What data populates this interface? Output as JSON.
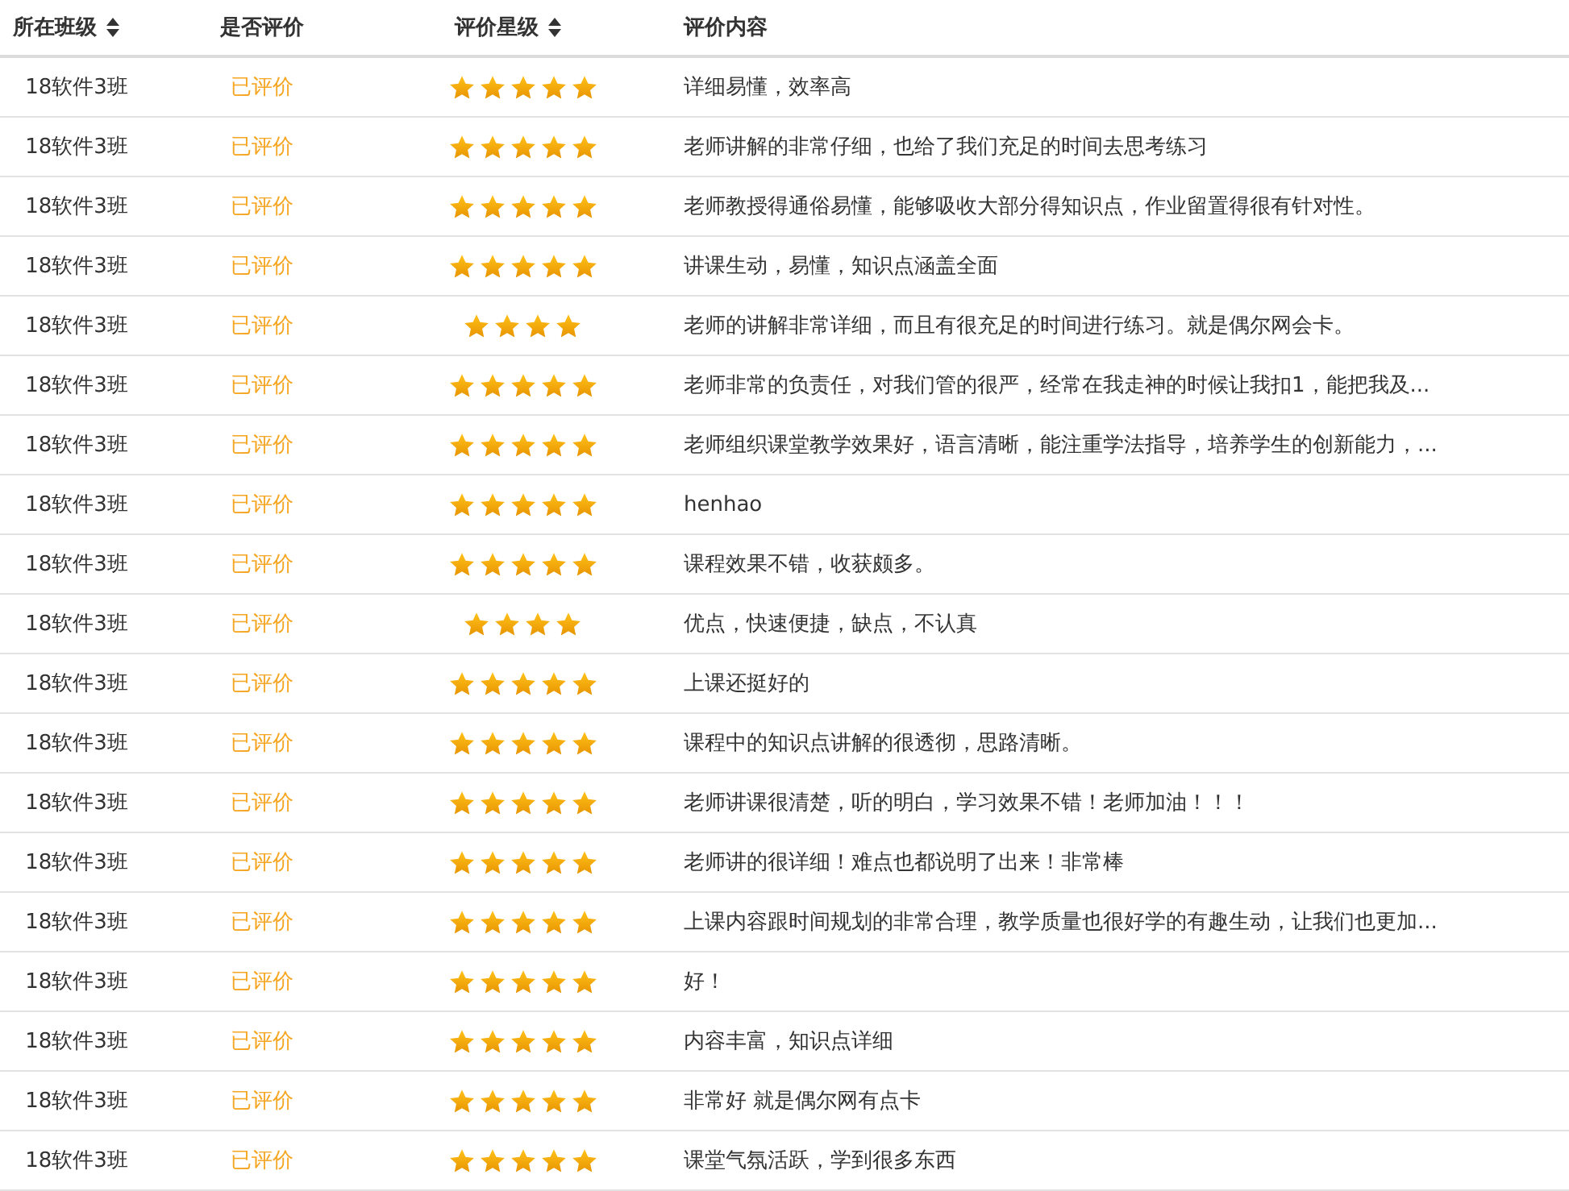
{
  "table": {
    "columns": [
      {
        "label": "所在班级",
        "sortable": true
      },
      {
        "label": "是否评价",
        "sortable": false
      },
      {
        "label": "评价星级",
        "sortable": true
      },
      {
        "label": "评价内容",
        "sortable": false
      }
    ],
    "rows": [
      {
        "class": "18软件3班",
        "status": "已评价",
        "stars": 5,
        "comment": "详细易懂，效率高"
      },
      {
        "class": "18软件3班",
        "status": "已评价",
        "stars": 5,
        "comment": "老师讲解的非常仔细，也给了我们充足的时间去思考练习"
      },
      {
        "class": "18软件3班",
        "status": "已评价",
        "stars": 5,
        "comment": "老师教授得通俗易懂，能够吸收大部分得知识点，作业留置得很有针对性。"
      },
      {
        "class": "18软件3班",
        "status": "已评价",
        "stars": 5,
        "comment": "讲课生动，易懂，知识点涵盖全面"
      },
      {
        "class": "18软件3班",
        "status": "已评价",
        "stars": 4,
        "comment": "老师的讲解非常详细，而且有很充足的时间进行练习。就是偶尔网会卡。"
      },
      {
        "class": "18软件3班",
        "status": "已评价",
        "stars": 5,
        "comment": "老师非常的负责任，对我们管的很严，经常在我走神的时候让我扣1，能把我及..."
      },
      {
        "class": "18软件3班",
        "status": "已评价",
        "stars": 5,
        "comment": "老师组织课堂教学效果好，语言清晰，能注重学法指导，培养学生的创新能力，..."
      },
      {
        "class": "18软件3班",
        "status": "已评价",
        "stars": 5,
        "comment": "henhao"
      },
      {
        "class": "18软件3班",
        "status": "已评价",
        "stars": 5,
        "comment": "课程效果不错，收获颇多。"
      },
      {
        "class": "18软件3班",
        "status": "已评价",
        "stars": 4,
        "comment": "优点，快速便捷，缺点，不认真"
      },
      {
        "class": "18软件3班",
        "status": "已评价",
        "stars": 5,
        "comment": "上课还挺好的"
      },
      {
        "class": "18软件3班",
        "status": "已评价",
        "stars": 5,
        "comment": "课程中的知识点讲解的很透彻，思路清晰。"
      },
      {
        "class": "18软件3班",
        "status": "已评价",
        "stars": 5,
        "comment": "老师讲课很清楚，听的明白，学习效果不错！老师加油！！！"
      },
      {
        "class": "18软件3班",
        "status": "已评价",
        "stars": 5,
        "comment": "老师讲的很详细！难点也都说明了出来！非常棒"
      },
      {
        "class": "18软件3班",
        "status": "已评价",
        "stars": 5,
        "comment": "上课内容跟时间规划的非常合理，教学质量也很好学的有趣生动，让我们也更加..."
      },
      {
        "class": "18软件3班",
        "status": "已评价",
        "stars": 5,
        "comment": "好！"
      },
      {
        "class": "18软件3班",
        "status": "已评价",
        "stars": 5,
        "comment": "内容丰富，知识点详细"
      },
      {
        "class": "18软件3班",
        "status": "已评价",
        "stars": 5,
        "comment": "非常好 就是偶尔网有点卡"
      },
      {
        "class": "18软件3班",
        "status": "已评价",
        "stars": 5,
        "comment": "课堂气氛活跃，学到很多东西"
      }
    ]
  }
}
